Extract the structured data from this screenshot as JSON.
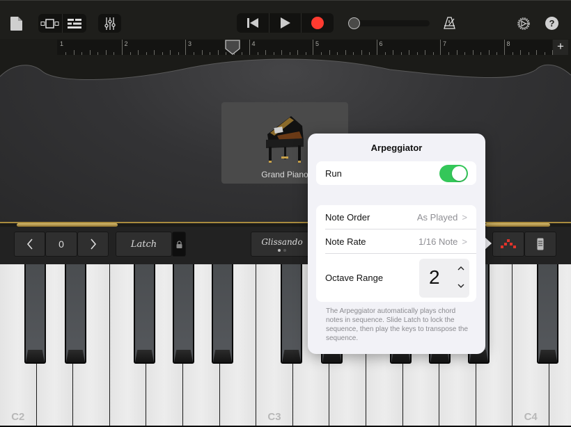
{
  "toolbar": {
    "document_icon": "document-icon",
    "view_tracks_icon": "tracks-view-icon",
    "view_list_icon": "list-view-icon",
    "mixer_icon": "mixer-icon",
    "rewind_icon": "rewind-icon",
    "play_icon": "play-icon",
    "record_icon": "record-icon",
    "record_color": "#ff3b30",
    "volume": 0,
    "metronome_icon": "metronome-icon",
    "settings_icon": "settings-icon",
    "help_icon": "help-icon",
    "help_label": "?"
  },
  "ruler": {
    "bars": [
      "1",
      "2",
      "3",
      "4",
      "5",
      "6",
      "7",
      "8"
    ],
    "add_label": "+",
    "playhead_bar": 3.7
  },
  "instrument": {
    "name": "Grand Piano"
  },
  "controls": {
    "octave_down": "<",
    "octave_value": "0",
    "octave_up": ">",
    "latch_label": "Latch",
    "glissando_label": "Glissando",
    "glissando_page": 1,
    "glissando_pages": 2,
    "arpeggiator_icon": "arpeggiator-icon",
    "arpeggiator_color": "#e0342b",
    "keyboard_settings_icon": "keyboard-settings-icon"
  },
  "keyboard": {
    "labels": {
      "c2": "C2",
      "c3": "C3",
      "c4": "C4"
    }
  },
  "popover": {
    "title": "Arpeggiator",
    "run_label": "Run",
    "run_on": true,
    "toggle_color": "#34c759",
    "note_order_label": "Note Order",
    "note_order_value": "As Played",
    "note_rate_label": "Note Rate",
    "note_rate_value": "1/16 Note",
    "octave_range_label": "Octave Range",
    "octave_range_value": "2",
    "chevron": ">",
    "footnote": "The Arpeggiator automatically plays chord notes in sequence. Slide Latch to lock the sequence, then play the keys to transpose the sequence."
  }
}
